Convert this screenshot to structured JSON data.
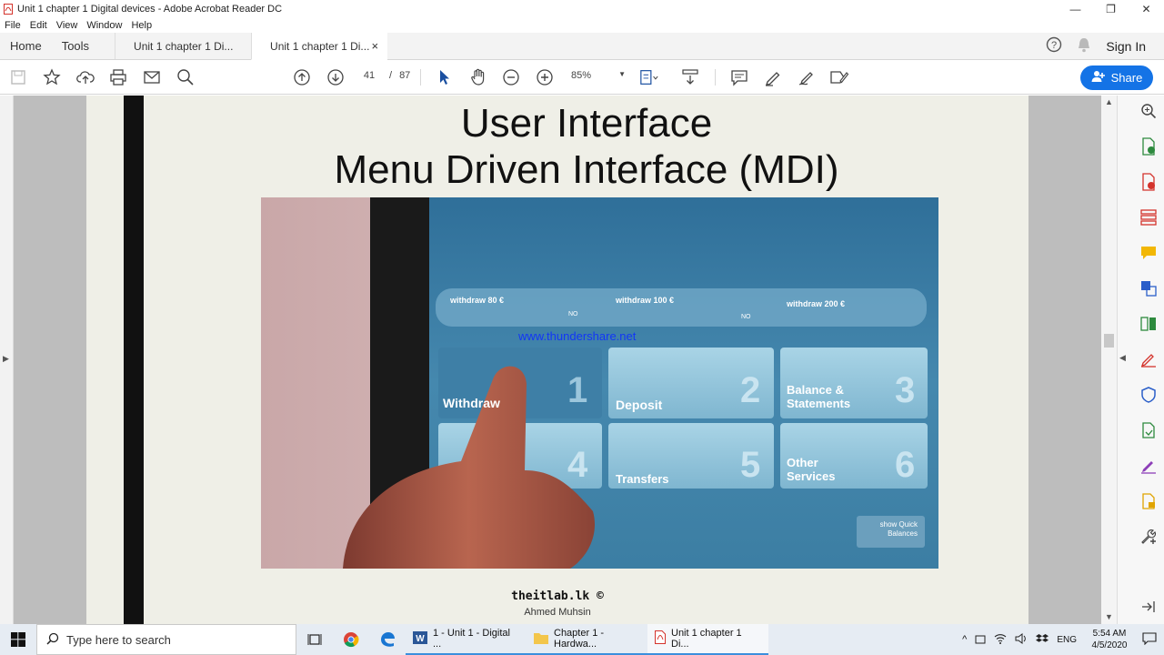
{
  "window": {
    "title": "Unit 1  chapter 1 Digital devices - Adobe Acrobat Reader DC"
  },
  "menu": [
    "File",
    "Edit",
    "View",
    "Window",
    "Help"
  ],
  "nav": {
    "home": "Home",
    "tools": "Tools"
  },
  "tabs": [
    {
      "label": "Unit 1  chapter 1 Di...",
      "active": false
    },
    {
      "label": "Unit 1  chapter 1 Di...",
      "active": true,
      "close": "×"
    }
  ],
  "header": {
    "sign_in": "Sign In"
  },
  "toolbar": {
    "page_current": "41",
    "page_sep": "/",
    "page_total": "87",
    "zoom": "85%",
    "share_label": "Share"
  },
  "slide": {
    "title_line1": "User Interface",
    "title_line2": "Menu Driven Interface (MDI)",
    "watermark": "www.thundershare.net",
    "footer_brand": "theitlab.lk ©",
    "footer_author": "Ahmed Muhsin"
  },
  "atm": {
    "quick": [
      {
        "label": "withdraw 80 €",
        "tag": "NO"
      },
      {
        "label": "withdraw 100 €",
        "tag": "NO"
      },
      {
        "label": "withdraw 200 €",
        "tag": ""
      }
    ],
    "tiles": [
      {
        "label": "Withdraw",
        "num": "1"
      },
      {
        "label": "Deposit",
        "num": "2"
      },
      {
        "label": "Balance &\nStatements",
        "num": "3"
      },
      {
        "label": "",
        "num": "4"
      },
      {
        "label": "Transfers",
        "num": "5"
      },
      {
        "label": "Other\nServices",
        "num": "6"
      }
    ],
    "show_quick": "show Quick\nBalances"
  },
  "taskbar": {
    "search_placeholder": "Type here to search",
    "apps": [
      {
        "label": "1 - Unit 1 - Digital ..."
      },
      {
        "label": "Chapter 1 - Hardwa..."
      },
      {
        "label": "Unit 1  chapter 1 Di..."
      }
    ],
    "lang": "ENG",
    "time": "5:54 AM",
    "date": "4/5/2020"
  },
  "colors": {
    "share": "#1473e6",
    "acrobat_red": "#d4332c",
    "page_bg": "#efefe7",
    "doc_bg": "#bdbdbd"
  }
}
